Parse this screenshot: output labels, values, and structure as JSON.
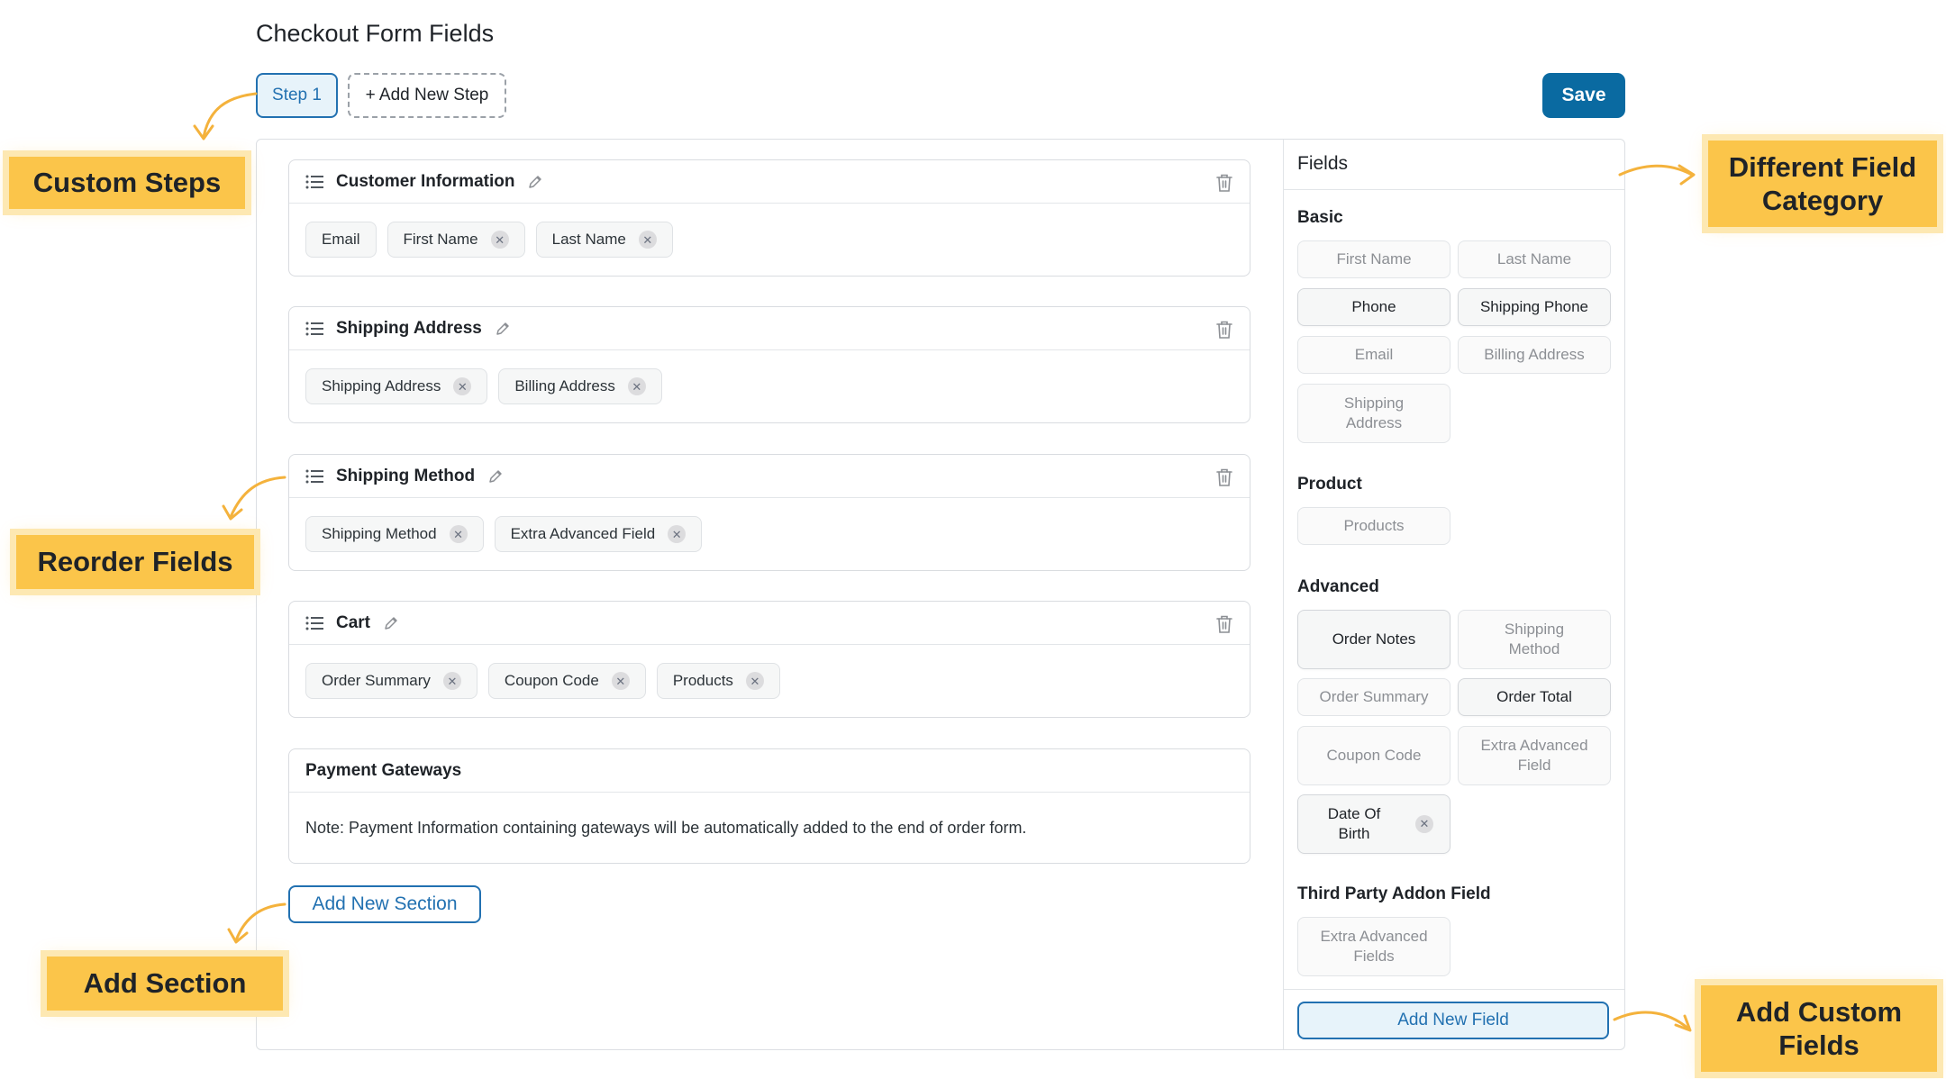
{
  "page": {
    "title": "Checkout Form Fields"
  },
  "steps": [
    {
      "label": "Step 1"
    },
    {
      "label": "+ Add New Step"
    }
  ],
  "toolbar": {
    "save_label": "Save"
  },
  "sections": [
    {
      "title": "Customer Information",
      "chips": [
        {
          "label": "Email",
          "removable": false
        },
        {
          "label": "First Name",
          "removable": true
        },
        {
          "label": "Last Name",
          "removable": true
        }
      ]
    },
    {
      "title": "Shipping Address",
      "chips": [
        {
          "label": "Shipping Address",
          "removable": true
        },
        {
          "label": "Billing Address",
          "removable": true
        }
      ]
    },
    {
      "title": "Shipping Method",
      "chips": [
        {
          "label": "Shipping Method",
          "removable": true
        },
        {
          "label": "Extra Advanced Field",
          "removable": true
        }
      ]
    },
    {
      "title": "Cart",
      "chips": [
        {
          "label": "Order Summary",
          "removable": true
        },
        {
          "label": "Coupon Code",
          "removable": true
        },
        {
          "label": "Products",
          "removable": true
        }
      ]
    }
  ],
  "payment": {
    "title": "Payment Gateways",
    "note": "Note: Payment Information containing gateways will be automatically added to the end of order form."
  },
  "add_section_label": "Add New Section",
  "fields_panel": {
    "title": "Fields",
    "categories": [
      {
        "title": "Basic",
        "fields": [
          "First Name",
          "Last Name",
          "Phone",
          "Shipping Phone",
          "Email",
          "Billing Address",
          "Shipping Address"
        ]
      },
      {
        "title": "Product",
        "fields": [
          "Products"
        ]
      },
      {
        "title": "Advanced",
        "fields": [
          "Order Notes",
          "Shipping Method",
          "Order Summary",
          "Order Total",
          "Coupon Code",
          "Extra Advanced Field",
          "Date Of Birth"
        ]
      },
      {
        "title": "Third Party Addon Field",
        "fields": [
          "Extra Advanced Fields"
        ]
      }
    ],
    "add_field_label": "Add New Field"
  },
  "callouts": {
    "custom_steps": "Custom Steps",
    "reorder_fields": "Reorder Fields",
    "add_section": "Add Section",
    "field_category": "Different Field Category",
    "custom_fields": "Add Custom Fields"
  },
  "colors": {
    "accent": "#2271b1",
    "save": "#0a6aa1",
    "callout": "#fbc54a",
    "callout_glow": "#fde8b2"
  }
}
